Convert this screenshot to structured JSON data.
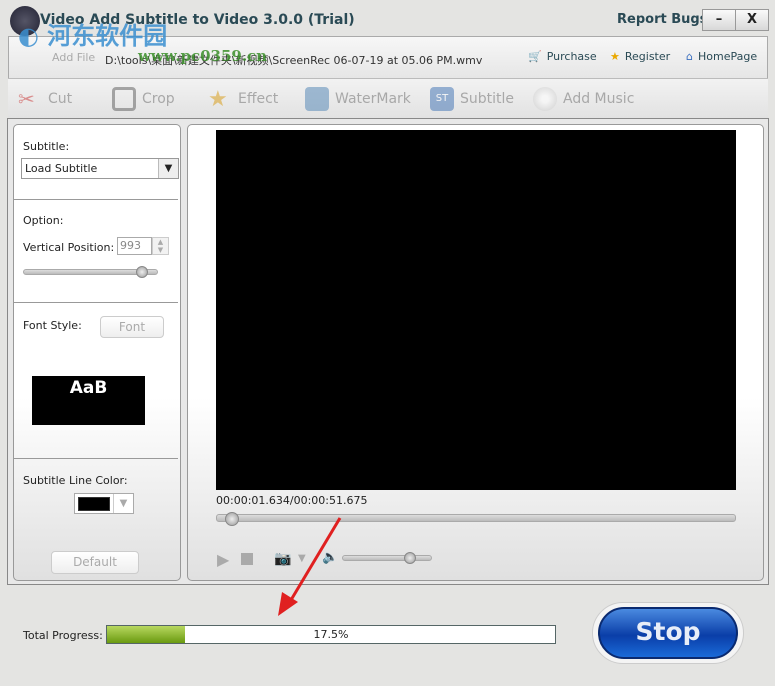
{
  "window": {
    "title": "Video Add Subtitle to Video 3.0.0 (Trial)",
    "report_bugs": "Report Bugs",
    "minimize": "–",
    "close": "X"
  },
  "watermark": {
    "name": "河东软件园",
    "url": "www.pc0359.cn"
  },
  "filebar": {
    "add_file": "Add File",
    "path": "D:\\tools\\桌面\\新建文件夹\\新视频\\ScreenRec 06-07-19 at 05.06 PM.wmv",
    "purchase": "Purchase",
    "register": "Register",
    "homepage": "HomePage"
  },
  "toolbar": {
    "cut": "Cut",
    "crop": "Crop",
    "effect": "Effect",
    "watermark": "WaterMark",
    "subtitle": "Subtitle",
    "add_music": "Add Music"
  },
  "left": {
    "subtitle_label": "Subtitle:",
    "subtitle_select": "Load Subtitle",
    "option_label": "Option:",
    "vpos_label": "Vertical Position:",
    "vpos_value": "993",
    "vpos_fraction": 0.88,
    "font_style_label": "Font Style:",
    "font_button": "Font",
    "preview_text": "AaB",
    "line_color_label": "Subtitle Line Color:",
    "line_color": "#000000",
    "default_button": "Default"
  },
  "player": {
    "time": "00:00:01.634/00:00:51.675",
    "seek_fraction": 0.03,
    "volume_fraction": 0.75
  },
  "progress": {
    "label": "Total Progress:",
    "percent_text": "17.5%",
    "fraction": 0.175,
    "stop": "Stop"
  }
}
